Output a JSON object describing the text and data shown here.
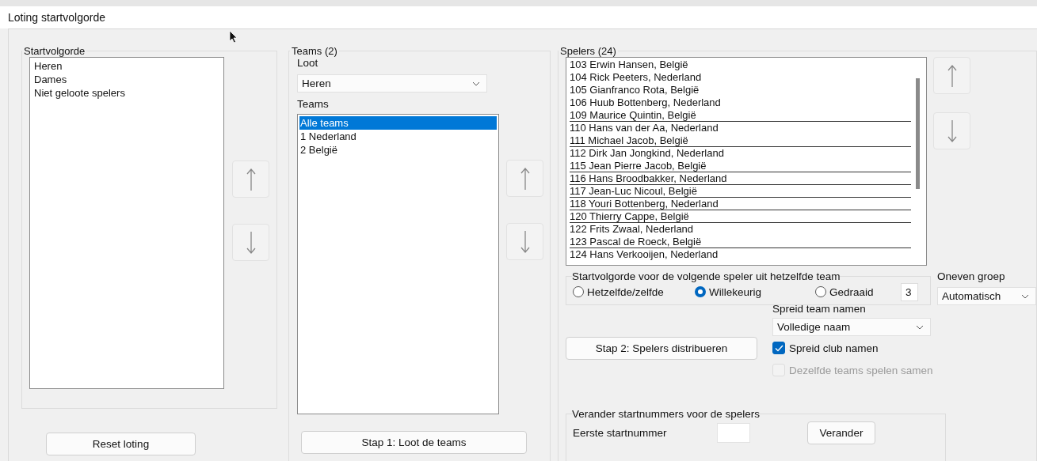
{
  "window": {
    "title": "Loting startvolgorde"
  },
  "startorder": {
    "title": "Startvolgorde",
    "items": [
      {
        "label": "Heren",
        "selected": false
      },
      {
        "label": "Dames",
        "selected": false
      },
      {
        "label": "Niet geloote spelers",
        "selected": false
      }
    ],
    "button": "Reset loting"
  },
  "teams": {
    "title": "Teams (2)",
    "loot_label": "Loot",
    "loot_value": "Heren",
    "list_label": "Teams",
    "items": [
      {
        "label": "Alle teams",
        "selected": true
      },
      {
        "label": "1 Nederland",
        "selected": false
      },
      {
        "label": "2 België",
        "selected": false
      }
    ],
    "button": "Stap 1: Loot de teams"
  },
  "players": {
    "title": "Spelers (24)",
    "items": [
      {
        "label": "103 Erwin Hansen, België",
        "divider_below": false
      },
      {
        "label": "104 Rick Peeters, Nederland",
        "divider_below": false
      },
      {
        "label": "105 Gianfranco Rota, België",
        "divider_below": false
      },
      {
        "label": "106 Huub Bottenberg, Nederland",
        "divider_below": false
      },
      {
        "label": "109 Maurice Quintin, België",
        "divider_below": true
      },
      {
        "label": "110 Hans van der Aa, Nederland",
        "divider_below": false
      },
      {
        "label": "111 Michael Jacob, België",
        "divider_below": true
      },
      {
        "label": "112 Dirk Jan Jongkind, Nederland",
        "divider_below": false
      },
      {
        "label": "115 Jean Pierre Jacob, België",
        "divider_below": true
      },
      {
        "label": "116 Hans Broodbakker, Nederland",
        "divider_below": true
      },
      {
        "label": "117 Jean-Luc Nicoul, België",
        "divider_below": true
      },
      {
        "label": "118 Youri Bottenberg, Nederland",
        "divider_below": true
      },
      {
        "label": "120 Thierry Cappe, België",
        "divider_below": true
      },
      {
        "label": "122 Frits Zwaal, Nederland",
        "divider_below": false
      },
      {
        "label": "123 Pascal de Roeck, België",
        "divider_below": true
      },
      {
        "label": "124 Hans Verkooijen, Nederland",
        "divider_below": false
      }
    ],
    "order_group": {
      "title": "Startvolgorde voor de volgende speler uit hetzelfde team",
      "options": [
        {
          "label": "Hetzelfde/zelfde",
          "selected": false
        },
        {
          "label": "Willekeurig",
          "selected": true
        },
        {
          "label": "Gedraaid",
          "selected": false
        }
      ],
      "value": "3"
    },
    "odd_group": {
      "label": "Oneven groep",
      "value": "Automatisch"
    },
    "spread": {
      "label": "Spreid team namen",
      "value": "Volledige naam"
    },
    "distribute_button": "Stap 2: Spelers distribueren",
    "checks": [
      {
        "label": "Spreid club namen",
        "checked": true,
        "disabled": false
      },
      {
        "label": "Dezelfde teams spelen samen",
        "checked": false,
        "disabled": true
      }
    ],
    "renumber": {
      "title": "Verander startnummers voor de spelers",
      "label": "Eerste startnummer",
      "button": "Verander"
    }
  }
}
